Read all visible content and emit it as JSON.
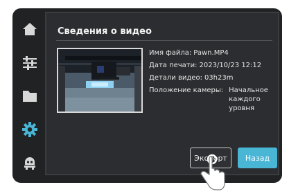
{
  "sidebar": {
    "items": [
      {
        "icon": "home-icon",
        "active": false
      },
      {
        "icon": "sliders-icon",
        "active": false
      },
      {
        "icon": "folder-icon",
        "active": false
      },
      {
        "icon": "gear-icon",
        "active": true
      },
      {
        "icon": "robot-icon",
        "active": false
      }
    ],
    "active_color": "#49b6d6",
    "inactive_color": "#d8d8d8"
  },
  "dialog": {
    "title": "Сведения о видео",
    "details": [
      {
        "label": "Имя файла:",
        "value": "Pawn.MP4"
      },
      {
        "label": "Дата печати:",
        "value": "2023/10/23 12:12"
      },
      {
        "label": "Детали видео:",
        "value": "03h23m"
      },
      {
        "label": "Положение камеры:",
        "value": "Начальное каждого уровня"
      }
    ],
    "export_label": "Экспорт",
    "back_label": "Назад"
  },
  "colors": {
    "accent": "#49b6d6",
    "panel": "#2b2d30",
    "device": "#202224"
  }
}
